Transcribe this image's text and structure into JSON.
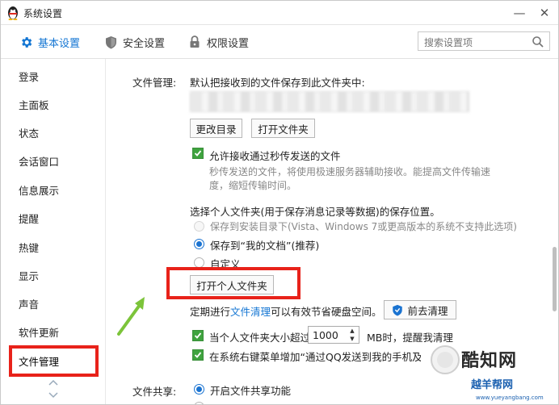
{
  "window": {
    "title": "系统设置",
    "controls": {
      "minimize": "—",
      "close": "✕"
    }
  },
  "tabs": [
    {
      "label": "基本设置",
      "icon": "gear-icon",
      "active": true
    },
    {
      "label": "安全设置",
      "icon": "shield-icon",
      "active": false
    },
    {
      "label": "权限设置",
      "icon": "lock-icon",
      "active": false
    }
  ],
  "search": {
    "placeholder": "搜索设置项"
  },
  "sidebar": {
    "items": [
      {
        "label": "登录"
      },
      {
        "label": "主面板"
      },
      {
        "label": "状态"
      },
      {
        "label": "会话窗口"
      },
      {
        "label": "信息展示"
      },
      {
        "label": "提醒"
      },
      {
        "label": "热键"
      },
      {
        "label": "显示"
      },
      {
        "label": "声音"
      },
      {
        "label": "软件更新"
      },
      {
        "label": "文件管理",
        "active": true
      }
    ]
  },
  "file_manage": {
    "section_label": "文件管理:",
    "default_save_text": "默认把接收到的文件保存到此文件夹中:",
    "change_dir_button": "更改目录",
    "open_folder_button": "打开文件夹",
    "allow_flash_label": "允许接收通过秒传发送的文件",
    "allow_flash_desc1": "秒传发送的文件，将使用极速服务器辅助接收。能提高文件传输速",
    "allow_flash_desc2": "度，缩短传输时间。",
    "personal_folder_title": "选择个人文件夹(用于保存消息记录等数据)的保存位置。",
    "radio_install_dir": "保存到安装目录下(Vista、Windows 7或更高版本的系统不支持此选项)",
    "radio_my_docs": "保存到“我的文档”(推荐)",
    "radio_custom": "自定义",
    "open_personal_button": "打开个人文件夹",
    "clean_prefix": "定期进行",
    "clean_link": "文件清理",
    "clean_suffix": "可以有效节省硬盘空间。",
    "clean_button": "前去清理",
    "size_check_prefix": "当个人文件夹大小超过",
    "size_value": "1000",
    "size_check_suffix": "MB时，提醒我清理",
    "context_menu_label": "在系统右键菜单增加“通过QQ发送到我的手机及好友”"
  },
  "file_share": {
    "section_label": "文件共享:",
    "enable_label": "开启文件共享功能"
  },
  "watermark": {
    "logo_text": "酷知网",
    "sub_text": "越羊帮网",
    "url": "www.yueyangbang.com"
  },
  "colors": {
    "accent": "#1476d3",
    "highlight": "#e8221a",
    "check_green": "#3fa33f",
    "arrow_green": "#7cc43a"
  }
}
